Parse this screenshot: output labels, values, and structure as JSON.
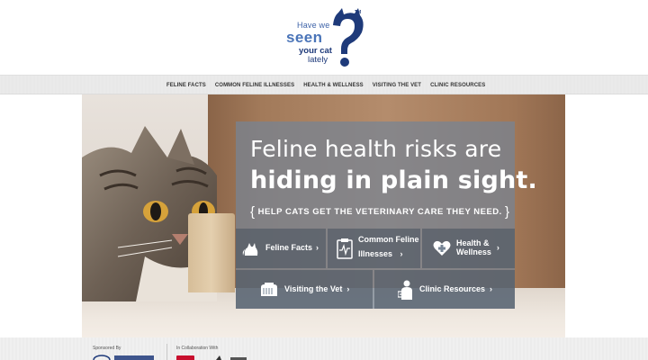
{
  "logo": {
    "have_we": "Have we",
    "seen": "seen",
    "your_cat": "your cat",
    "lately": "lately",
    "tm": "TM",
    "colors": {
      "primary": "#1e3a7a",
      "light": "#4a74b8"
    }
  },
  "nav": {
    "items": [
      {
        "label": "FELINE FACTS"
      },
      {
        "label": "COMMON FELINE ILLNESSES"
      },
      {
        "label": "HEALTH & WELLNESS"
      },
      {
        "label": "VISITING THE VET"
      },
      {
        "label": "CLINIC RESOURCES"
      }
    ]
  },
  "hero": {
    "headline_line1": "Feline health risks are",
    "headline_line2": "hiding in plain sight.",
    "tagline": "HELP CATS GET THE VETERINARY CARE THEY NEED.",
    "tiles": [
      {
        "label": "Feline Facts",
        "icon": "cat-icon"
      },
      {
        "label": "Common Feline Illnesses",
        "line1": "Common Feline",
        "line2": "Illnesses",
        "icon": "clipboard-heartbeat-icon"
      },
      {
        "label": "Health & Wellness",
        "line1": "Health &",
        "line2": "Wellness",
        "icon": "heart-cross-icon"
      },
      {
        "label": "Visiting the Vet",
        "icon": "cat-carrier-icon"
      },
      {
        "label": "Clinic Resources",
        "icon": "veterinarian-icon"
      }
    ],
    "arrow": "›",
    "panel_color": "#768494"
  },
  "footer": {
    "sponsored_by": "Sponsored By",
    "in_collaboration_with": "In Collaboration With"
  }
}
